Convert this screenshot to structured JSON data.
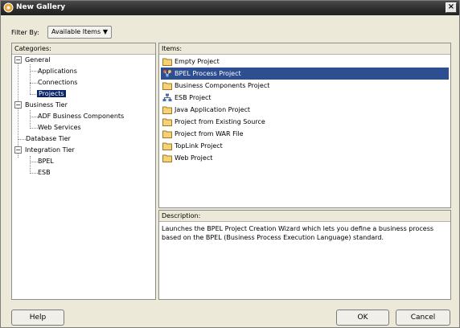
{
  "window": {
    "title": "New Gallery"
  },
  "filter": {
    "label": "Filter By:",
    "value": "Available Items"
  },
  "categories": {
    "header": "Categories:",
    "tree": [
      {
        "label": "General",
        "level": 0,
        "expanded": true
      },
      {
        "label": "Applications",
        "level": 1
      },
      {
        "label": "Connections",
        "level": 1
      },
      {
        "label": "Projects",
        "level": 1,
        "selected": true
      },
      {
        "label": "Business Tier",
        "level": 0,
        "expanded": true
      },
      {
        "label": "ADF Business Components",
        "level": 1
      },
      {
        "label": "Web Services",
        "level": 1
      },
      {
        "label": "Database Tier",
        "level": 0
      },
      {
        "label": "Integration Tier",
        "level": 0,
        "expanded": true
      },
      {
        "label": "BPEL",
        "level": 1
      },
      {
        "label": "ESB",
        "level": 1
      }
    ]
  },
  "items": {
    "header": "Items:",
    "list": [
      {
        "label": "Empty Project",
        "icon": "folder-icon"
      },
      {
        "label": "BPEL Process Project",
        "icon": "bpel-icon",
        "selected": true
      },
      {
        "label": "Business Components Project",
        "icon": "folder-icon"
      },
      {
        "label": "ESB Project",
        "icon": "esb-icon"
      },
      {
        "label": "Java Application Project",
        "icon": "folder-icon"
      },
      {
        "label": "Project from Existing Source",
        "icon": "folder-icon"
      },
      {
        "label": "Project from WAR File",
        "icon": "folder-icon"
      },
      {
        "label": "TopLink Project",
        "icon": "folder-icon"
      },
      {
        "label": "Web Project",
        "icon": "folder-icon"
      }
    ]
  },
  "description": {
    "header": "Description:",
    "text": "Launches the BPEL Project Creation Wizard which lets you define a business process based on the BPEL (Business Process Execution Language) standard."
  },
  "buttons": {
    "help": "Help",
    "ok": "OK",
    "cancel": "Cancel"
  },
  "colors": {
    "selection": "#2e4e92",
    "titlebar": "#2e2e2e"
  }
}
